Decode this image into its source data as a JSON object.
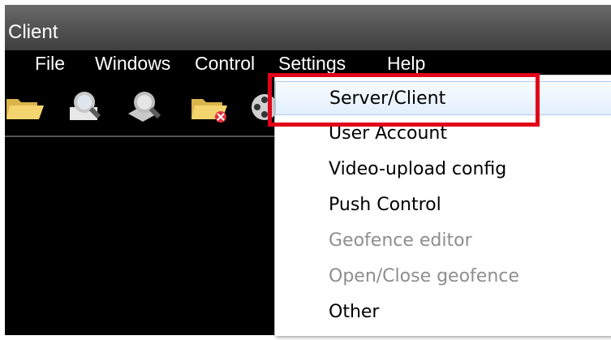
{
  "window": {
    "title": "Client"
  },
  "menubar": {
    "items": [
      {
        "label": "File"
      },
      {
        "label": "Windows"
      },
      {
        "label": "Control"
      },
      {
        "label": "Settings"
      },
      {
        "label": "Help"
      }
    ]
  },
  "toolbar": {
    "icons": [
      "folder-open-icon",
      "search-icon",
      "search-video-icon",
      "folder-delete-icon",
      "film-reel-icon"
    ]
  },
  "settings_menu": {
    "items": [
      {
        "label": "Server/Client",
        "enabled": true,
        "highlighted": true
      },
      {
        "label": "User Account",
        "enabled": true
      },
      {
        "label": "Video-upload config",
        "enabled": true
      },
      {
        "label": "Push Control",
        "enabled": true
      },
      {
        "label": "Geofence editor",
        "enabled": false
      },
      {
        "label": "Open/Close geofence",
        "enabled": false
      },
      {
        "label": "Other",
        "enabled": true
      }
    ]
  },
  "colors": {
    "highlight_box": "#e2001a",
    "disabled_text": "#8e8e8e",
    "folder": "#f2d06b"
  }
}
